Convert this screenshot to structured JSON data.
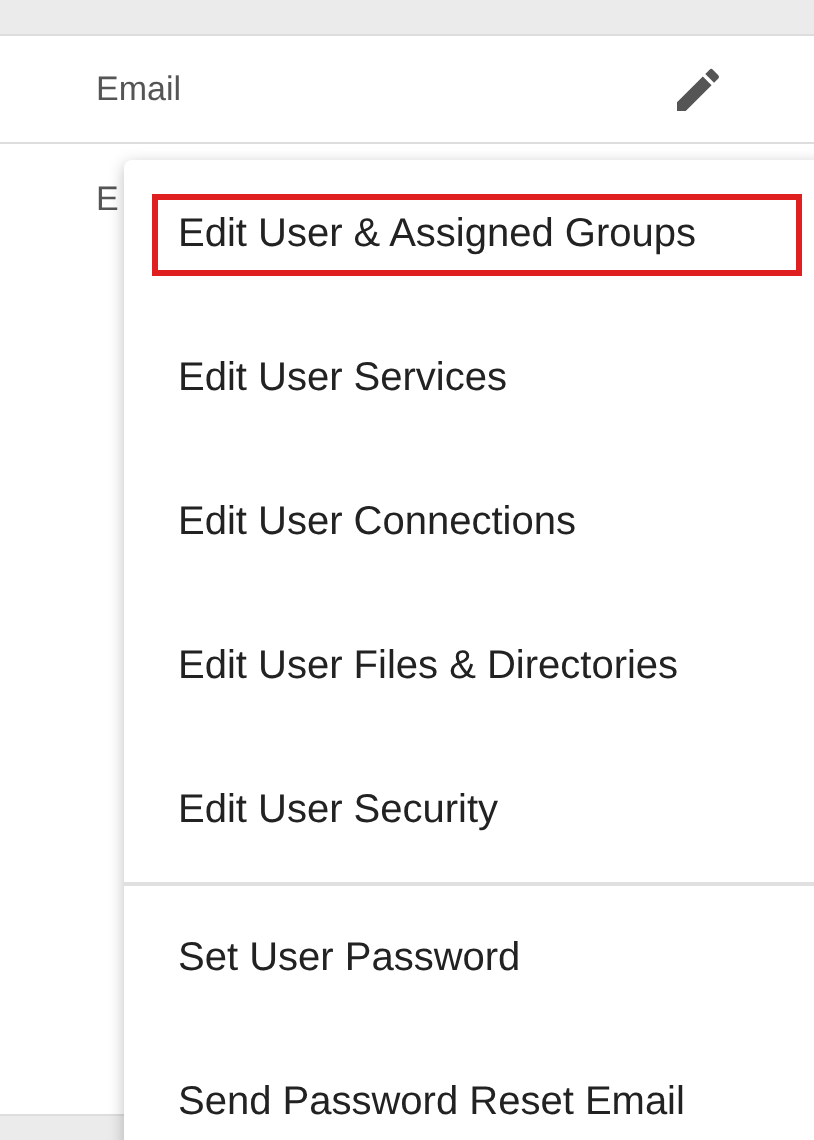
{
  "rows": [
    {
      "label": "Email",
      "editable": true
    },
    {
      "label": "E"
    }
  ],
  "menu": {
    "groups": [
      [
        {
          "label": "Edit User & Assigned Groups",
          "selected": true
        },
        {
          "label": "Edit User Services",
          "selected": false
        },
        {
          "label": "Edit User Connections",
          "selected": false
        },
        {
          "label": "Edit User Files & Directories",
          "selected": false
        },
        {
          "label": "Edit User Security",
          "selected": false
        }
      ],
      [
        {
          "label": "Set User Password",
          "selected": false
        },
        {
          "label": "Send Password Reset Email",
          "selected": false
        }
      ]
    ]
  }
}
